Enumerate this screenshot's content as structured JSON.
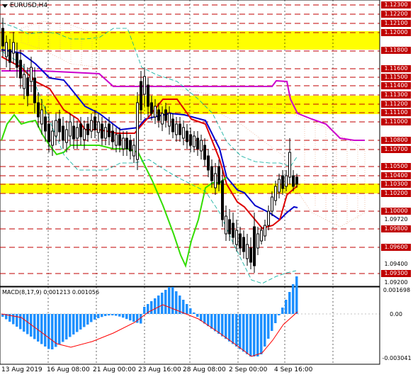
{
  "symbol": "EURUSD,H4",
  "macd_label": "MACD(8,17,9) 0.001213 0.001056",
  "colors": {
    "zone": "#ffff00",
    "level": "#c00000",
    "price_label_bg": "#c00000",
    "price_label_text": "#ffffff",
    "signal": "#ff0000",
    "macd_bar": "#1e90ff"
  },
  "price_axis": {
    "labels": [
      {
        "text": "1.12300",
        "red": true
      },
      {
        "text": "1.12200",
        "red": true
      },
      {
        "text": "1.12100",
        "red": true
      },
      {
        "text": "1.12000",
        "red": true
      },
      {
        "text": "1.11800",
        "red": true
      },
      {
        "text": "1.11600",
        "red": true
      },
      {
        "text": "1.11500",
        "red": true
      },
      {
        "text": "1.11400",
        "red": true
      },
      {
        "text": "1.11300",
        "red": true
      },
      {
        "text": "1.11200",
        "red": true
      },
      {
        "text": "1.11100",
        "red": true
      },
      {
        "text": "1.11000",
        "red": true
      },
      {
        "text": "1.10800",
        "red": true
      },
      {
        "text": "1.10700",
        "red": true
      },
      {
        "text": "1.10500",
        "red": true
      },
      {
        "text": "1.10400",
        "red": true
      },
      {
        "text": "1.10300",
        "red": true
      },
      {
        "text": "1.10200",
        "red": true
      },
      {
        "text": "1.10000",
        "red": true
      },
      {
        "text": "1.09720",
        "red": false
      },
      {
        "text": "1.09800",
        "red": true
      },
      {
        "text": "1.09600",
        "red": true
      },
      {
        "text": "1.09400",
        "red": false
      },
      {
        "text": "1.09300",
        "red": true
      },
      {
        "text": "1.09200",
        "red": false
      }
    ]
  },
  "macd_axis": [
    "0.001698",
    "0.00",
    "-0.003041"
  ],
  "time_axis": [
    "13 Aug 2019",
    "16 Aug 08:00",
    "21 Aug 00:00",
    "23 Aug 16:00",
    "28 Aug 08:00",
    "2 Sep 00:00",
    "4 Sep 16:00"
  ]
}
